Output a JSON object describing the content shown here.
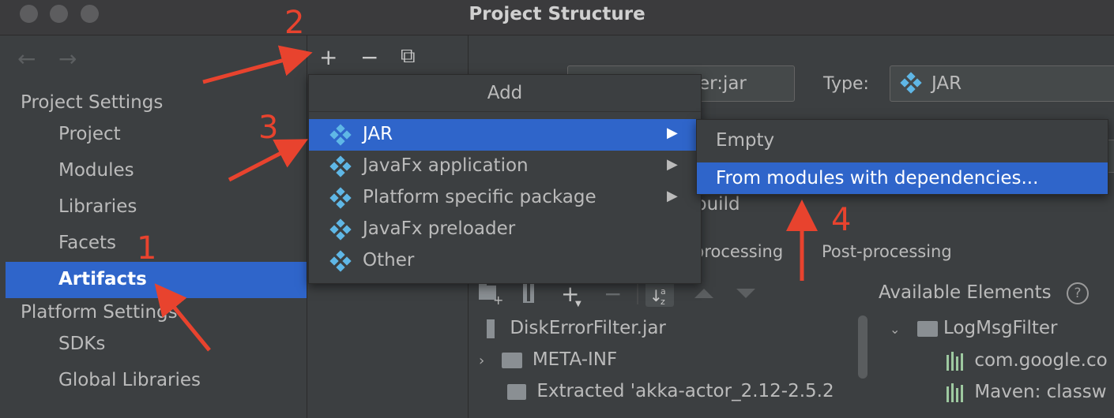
{
  "window": {
    "title": "Project Structure"
  },
  "nav": {
    "back": "←",
    "forward": "→"
  },
  "sidebar": {
    "project_settings": "Project Settings",
    "items": [
      "Project",
      "Modules",
      "Libraries",
      "Facets",
      "Artifacts"
    ],
    "platform_settings": "Platform Settings",
    "platform_items": [
      "SDKs",
      "Global Libraries"
    ],
    "selected": "Artifacts"
  },
  "toolbar": {
    "add": "+",
    "remove": "−",
    "copy": "⧉"
  },
  "artifact": {
    "name_value": "er:jar",
    "type_label": "Type:",
    "type_value": "JAR",
    "build_partial": "build",
    "tab_pre": "processing",
    "tab_post": "Post-processing"
  },
  "add_popup": {
    "title": "Add",
    "items": [
      "JAR",
      "JavaFx application",
      "Platform specific package",
      "JavaFx preloader",
      "Other"
    ],
    "selected": "JAR"
  },
  "submenu": {
    "items": [
      "Empty",
      "From modules with dependencies..."
    ],
    "selected": "From modules with dependencies..."
  },
  "output_tree": {
    "root": "DiskErrorFilter.jar",
    "children": [
      "META-INF",
      "Extracted 'akka-actor_2.12-2.5.2"
    ]
  },
  "available": {
    "title": "Available Elements",
    "root": "LogMsgFilter",
    "children": [
      "com.google.co",
      "Maven: classw"
    ]
  },
  "annotations": [
    "1",
    "2",
    "3",
    "4"
  ],
  "colors": {
    "accent": "#2f65ca",
    "annotation": "#e8432e",
    "diamond": "#5fb7e6"
  }
}
